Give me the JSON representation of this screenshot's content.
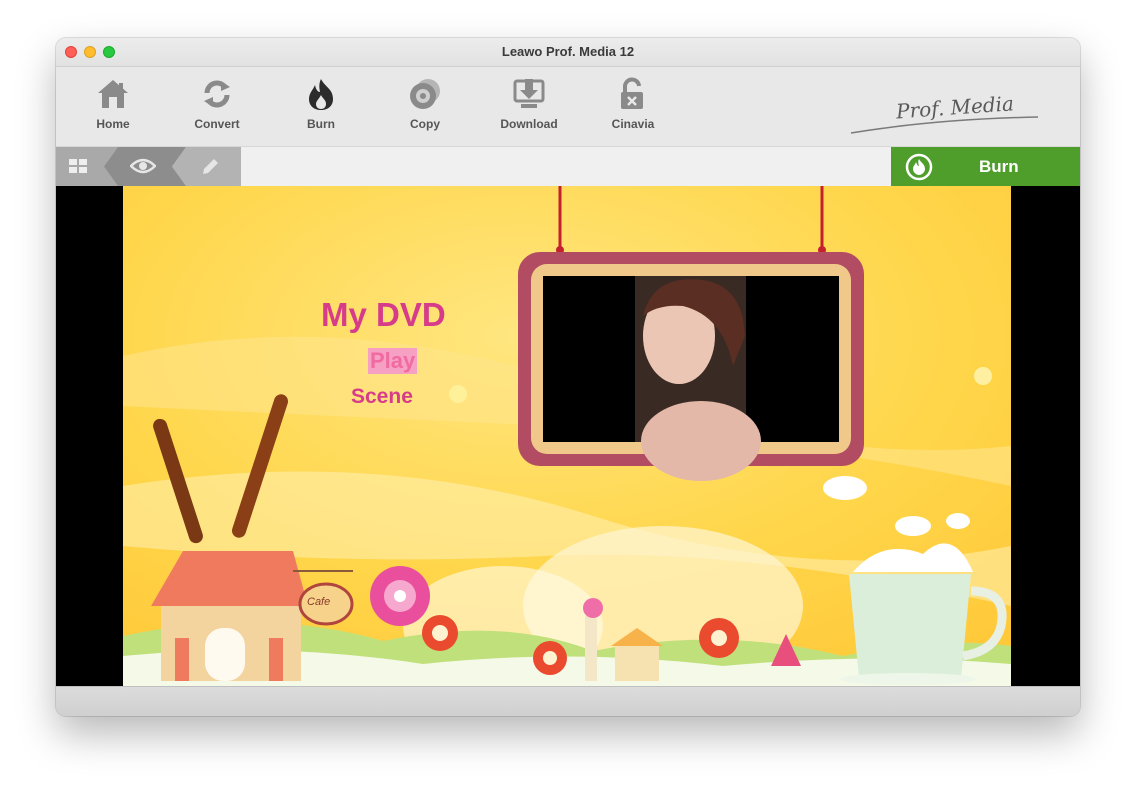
{
  "window": {
    "title": "Leawo Prof. Media 12"
  },
  "toolbar": {
    "items": [
      {
        "label": "Home",
        "icon": "home-icon"
      },
      {
        "label": "Convert",
        "icon": "convert-icon"
      },
      {
        "label": "Burn",
        "icon": "burn-flame-icon"
      },
      {
        "label": "Copy",
        "icon": "copy-disc-icon"
      },
      {
        "label": "Download",
        "icon": "download-icon"
      },
      {
        "label": "Cinavia",
        "icon": "cinavia-lock-icon"
      }
    ],
    "brand": "Prof. Media"
  },
  "subbar": {
    "burn_label": "Burn",
    "modes": [
      "grid-view-icon",
      "preview-eye-icon",
      "edit-pencil-icon"
    ]
  },
  "dvd_menu": {
    "title": "My DVD",
    "play": "Play",
    "scene": "Scene",
    "sign": "Cafe"
  },
  "colors": {
    "accent_green": "#4f9e2c",
    "menu_pink": "#d63c8a",
    "background_yellow": "#ffd84f"
  }
}
